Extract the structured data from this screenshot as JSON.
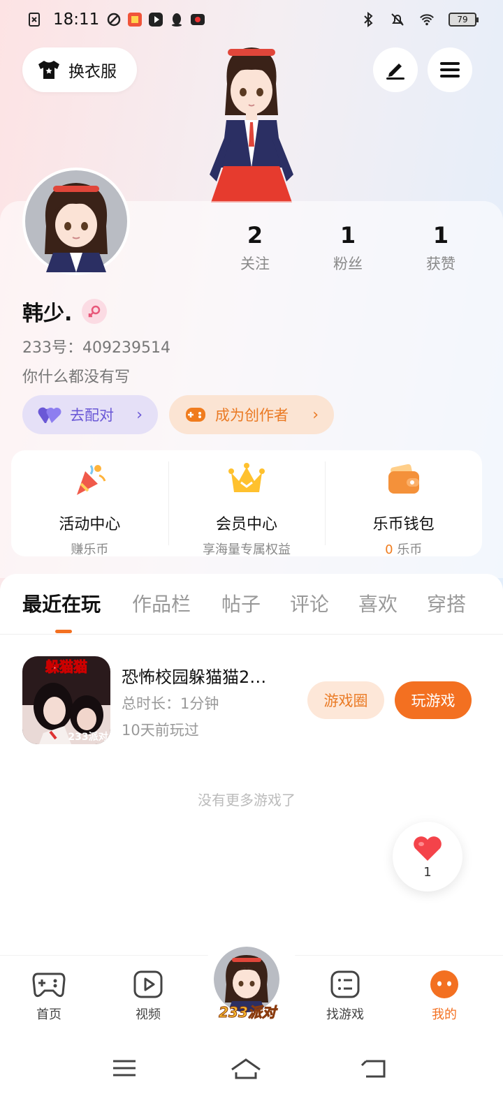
{
  "status_bar": {
    "time": "18:11",
    "battery": "79"
  },
  "header": {
    "outfit_label": "换衣服"
  },
  "profile": {
    "stats": [
      {
        "value": "2",
        "label": "关注"
      },
      {
        "value": "1",
        "label": "粉丝"
      },
      {
        "value": "1",
        "label": "获赞"
      }
    ],
    "username": "韩少.",
    "uid": "233号：409239514",
    "bio": "你什么都没有写",
    "match_label": "去配对",
    "creator_label": "成为创作者"
  },
  "features": [
    {
      "title": "活动中心",
      "subtitle": "赚乐币",
      "icon": "party-popper-icon"
    },
    {
      "title": "会员中心",
      "subtitle": "享海量专属权益",
      "icon": "crown-icon"
    },
    {
      "title": "乐币钱包",
      "subtitle_value": "0",
      "subtitle_unit": "乐币",
      "icon": "wallet-icon"
    }
  ],
  "tabs": [
    "最近在玩",
    "作品栏",
    "帖子",
    "评论",
    "喜欢",
    "穿搭"
  ],
  "active_tab": "最近在玩",
  "recent_games": [
    {
      "title": "恐怖校园躲猫猫2…",
      "icon_text": "躲猫猫",
      "icon_badge": "233派对",
      "duration": "总时长：1分钟",
      "last_played": "10天前玩过",
      "circle_button": "游戏圈",
      "play_button": "玩游戏"
    }
  ],
  "no_more_text": "没有更多游戏了",
  "like_count": "1",
  "bottom_nav": [
    {
      "label": "首页",
      "icon": "gamepad-icon"
    },
    {
      "label": "视频",
      "icon": "video-play-icon"
    },
    {
      "label": "233派对",
      "icon": "party-avatar"
    },
    {
      "label": "找游戏",
      "icon": "list-icon"
    },
    {
      "label": "我的",
      "icon": "profile-face-icon"
    }
  ],
  "colors": {
    "accent": "#f37021",
    "match": "#6a58d6",
    "creator": "#ea7a24"
  }
}
